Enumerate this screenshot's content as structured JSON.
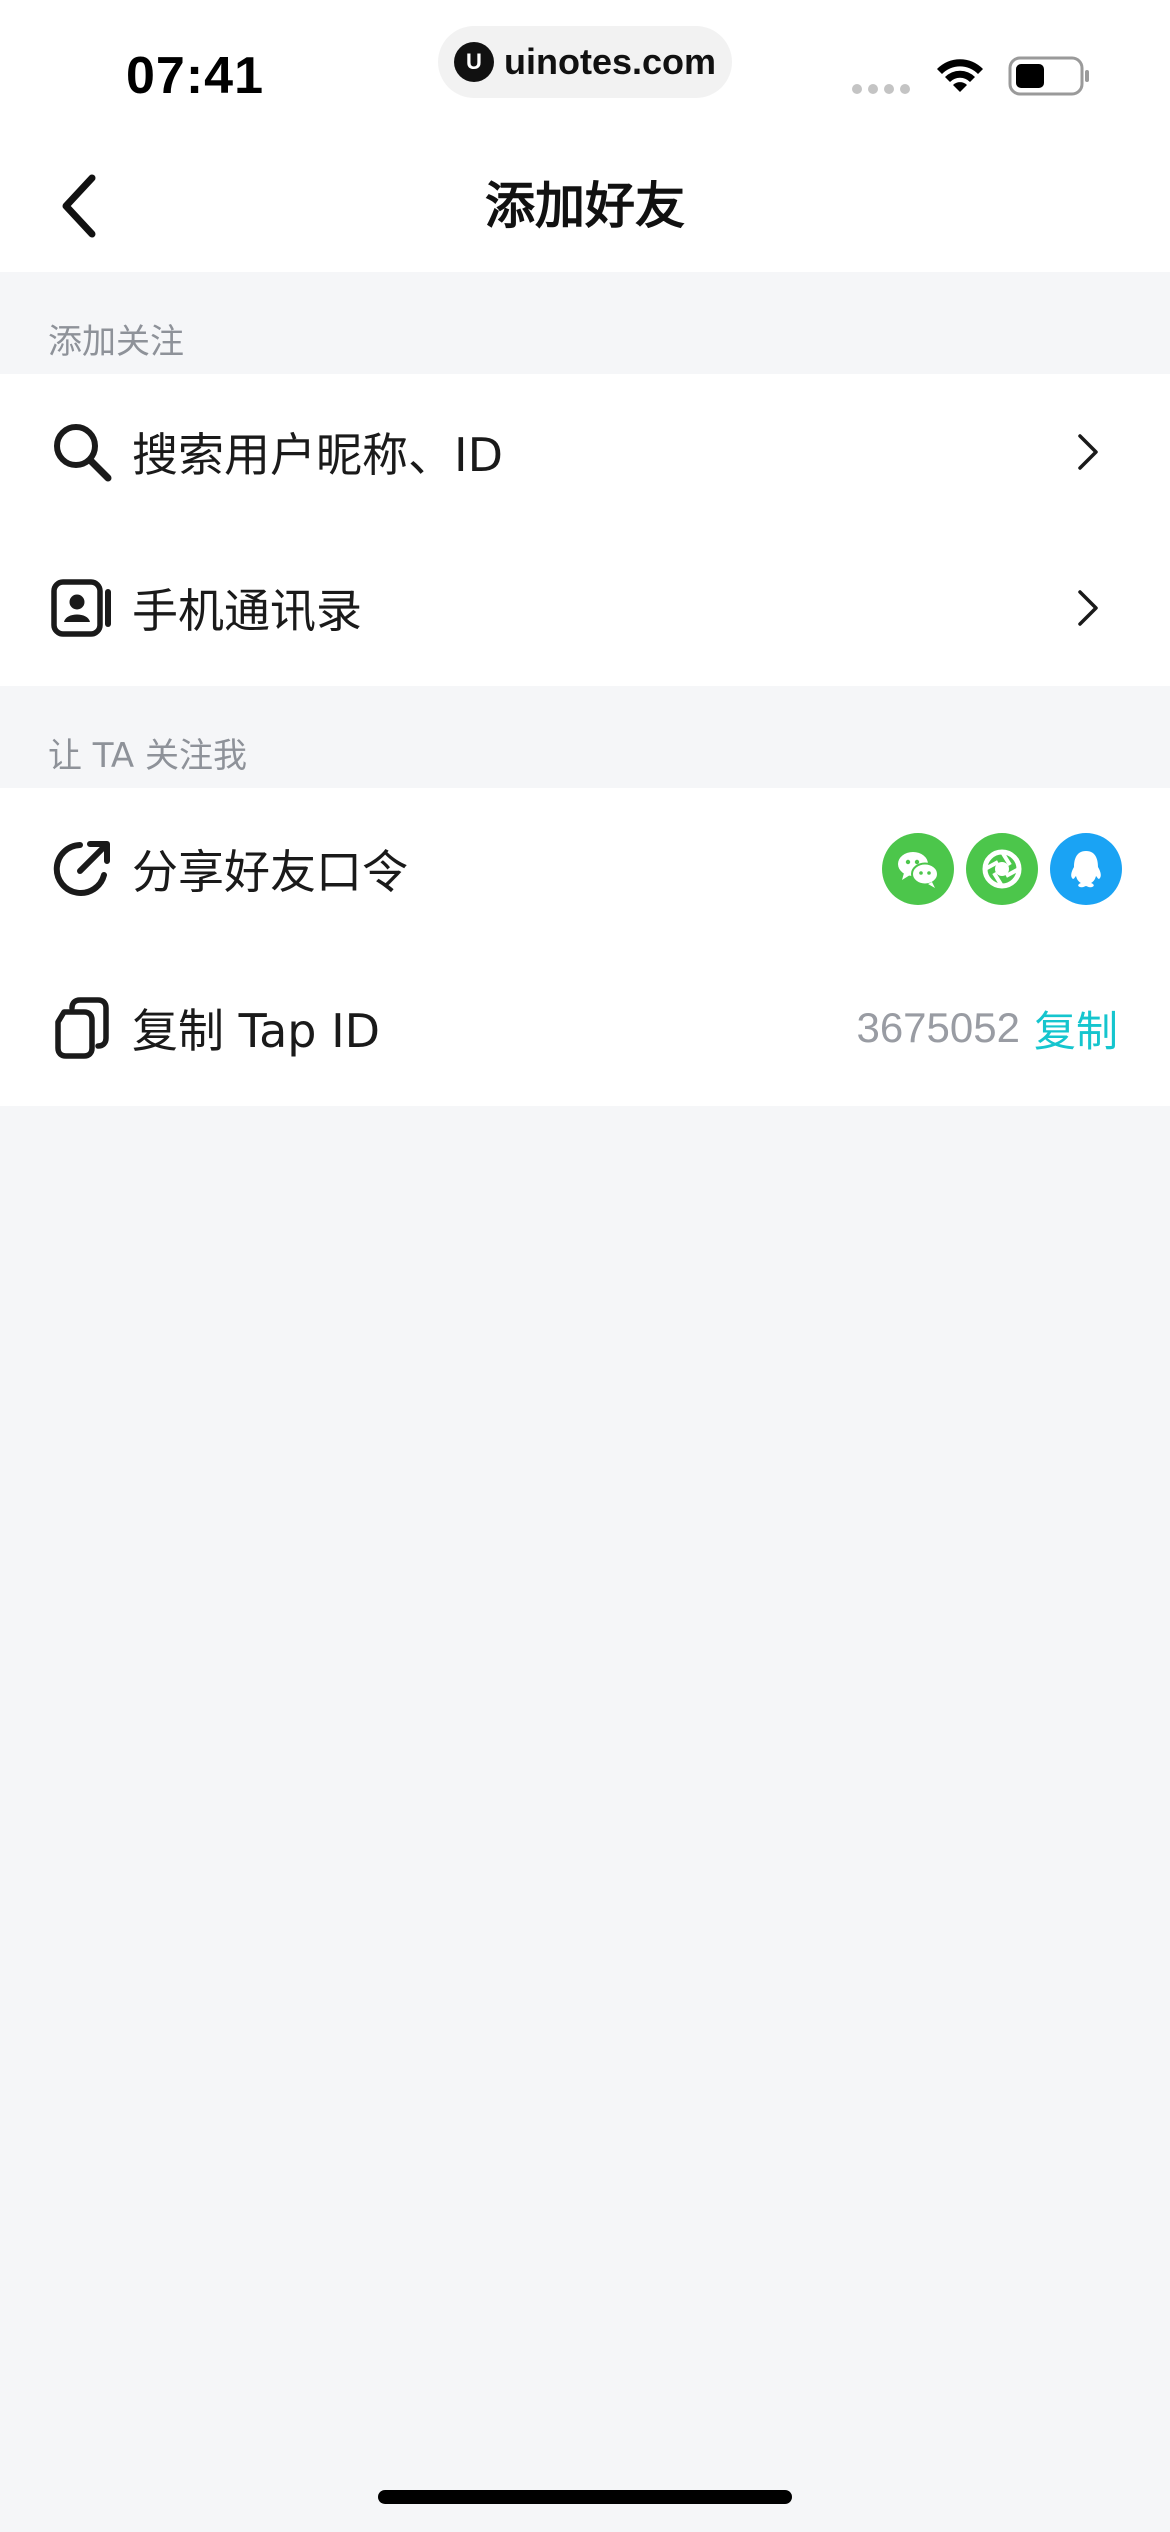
{
  "status_bar": {
    "time": "07:41",
    "url": "uinotes.com",
    "url_logo": "U"
  },
  "nav": {
    "title": "添加好友"
  },
  "section_follow": {
    "header": "添加关注",
    "items": [
      {
        "label": "搜索用户昵称、ID",
        "icon": "search-icon"
      },
      {
        "label": "手机通讯录",
        "icon": "contacts-icon"
      }
    ]
  },
  "section_invite": {
    "header": "让 TA 关注我",
    "share": {
      "label": "分享好友口令",
      "icon": "share-icon",
      "targets": [
        "wechat-icon",
        "moments-icon",
        "qq-icon"
      ]
    },
    "copy": {
      "label": "复制 Tap ID",
      "icon": "copy-icon",
      "tap_id": "3675052",
      "action": "复制"
    }
  },
  "colors": {
    "accent": "#15c5ce",
    "wechat": "#4cc64b",
    "qq": "#1aa3f4",
    "background": "#f5f6f8"
  }
}
